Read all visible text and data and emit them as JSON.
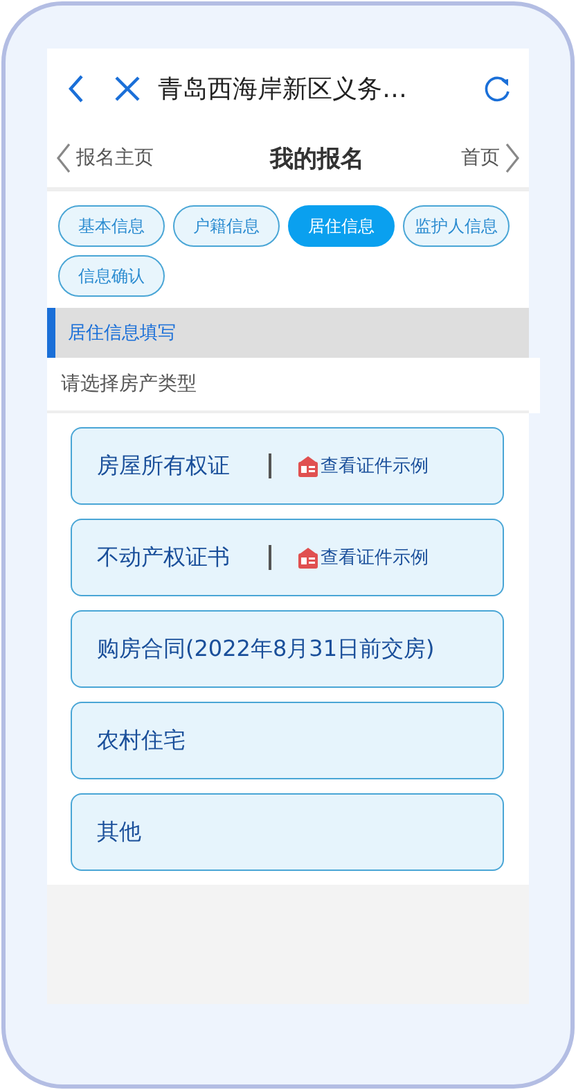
{
  "browser_bar": {
    "title": "青岛西海岸新区义务…"
  },
  "nav": {
    "back": "报名主页",
    "title": "我的报名",
    "forward": "首页"
  },
  "tabs": [
    {
      "label": "基本信息",
      "selected": false
    },
    {
      "label": "户籍信息",
      "selected": false
    },
    {
      "label": "居住信息",
      "selected": true
    },
    {
      "label": "监护人信息",
      "selected": false
    },
    {
      "label": "信息确认",
      "selected": false
    }
  ],
  "section": {
    "title": "居住信息填写",
    "prompt": "请选择房产类型"
  },
  "options": [
    {
      "label": "房屋所有权证",
      "kind": "with-example",
      "example": "查看证件示例"
    },
    {
      "label": "不动产权证书",
      "kind": "with-example",
      "example": "查看证件示例"
    },
    {
      "label": "购房合同(2022年8月31日前交房)",
      "kind": "plain"
    },
    {
      "label": "农村住宅",
      "kind": "plain"
    },
    {
      "label": "其他",
      "kind": "plain"
    }
  ]
}
